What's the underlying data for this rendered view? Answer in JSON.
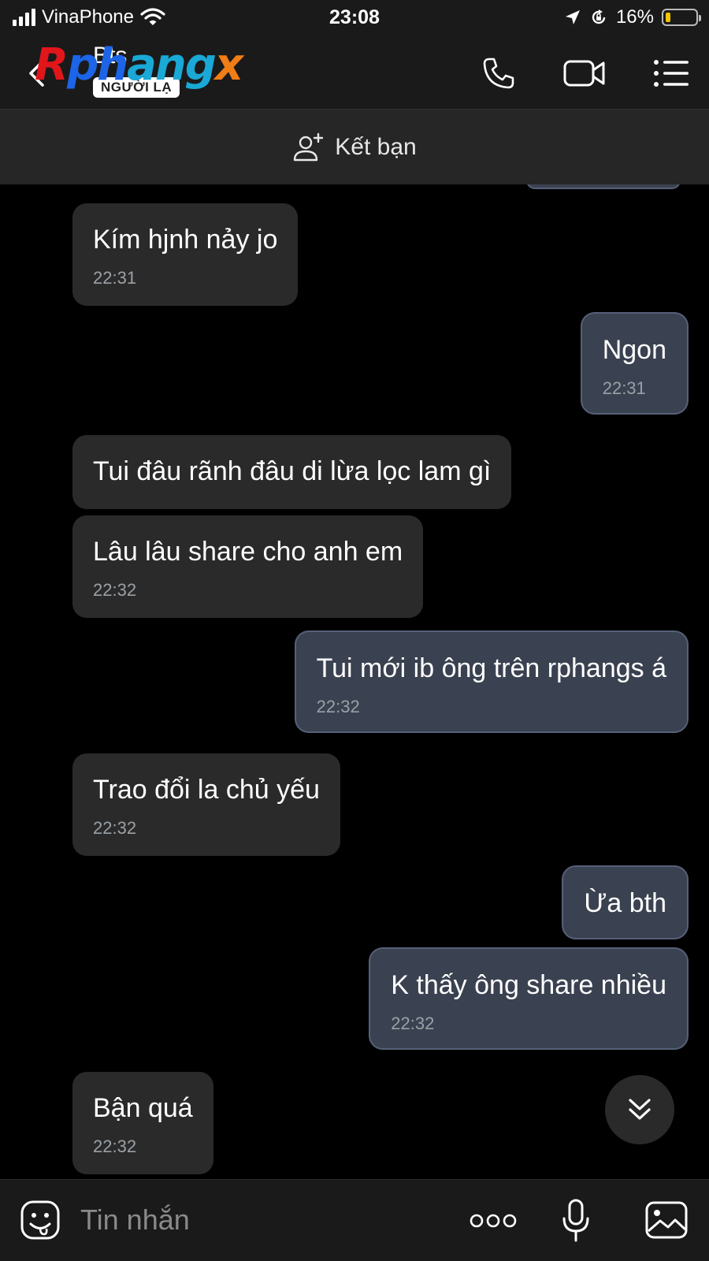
{
  "status_bar": {
    "carrier": "VinaPhone",
    "time": "23:08",
    "battery_percent": "16%",
    "battery_level": 0.16
  },
  "header": {
    "contact_name": "Bts",
    "stranger_badge": "NGƯỜI LẠ",
    "watermark": "Rphangx",
    "icons": [
      "back-chevron-icon",
      "phone-icon",
      "video-camera-icon",
      "menu-list-icon"
    ]
  },
  "friend_bar": {
    "label": "Kết bạn",
    "icon": "add-user-icon"
  },
  "messages": [
    {
      "direction": "in",
      "text": "Kím hjnh nảy jo",
      "time": "22:31"
    },
    {
      "direction": "out",
      "text": "Ngon",
      "time": "22:31"
    },
    {
      "direction": "in",
      "text": "Tui đâu rãnh đâu di lừa lọc lam gì",
      "time": ""
    },
    {
      "direction": "in",
      "text": "Lâu lâu share cho anh em",
      "time": "22:32"
    },
    {
      "direction": "out",
      "text": "Tui mới ib ông trên rphangs á",
      "time": "22:32"
    },
    {
      "direction": "in",
      "text": "Trao đổi la chủ yếu",
      "time": "22:32"
    },
    {
      "direction": "out",
      "text": "Ừa bth",
      "time": ""
    },
    {
      "direction": "out",
      "text": "K thấy ông share nhiều",
      "time": "22:32"
    },
    {
      "direction": "in",
      "text": "Bận quá",
      "time": "22:32"
    }
  ],
  "input_bar": {
    "placeholder": "Tin nhắn",
    "icons": [
      "sticker-icon",
      "more-dots-icon",
      "microphone-icon",
      "image-icon"
    ]
  },
  "colors": {
    "background": "#000000",
    "bar_background": "#1a1a1a",
    "incoming_bubble": "#2a2a2a",
    "outgoing_bubble": "#3a4150",
    "outgoing_border": "#566078",
    "timestamp": "#9aa0a6"
  }
}
